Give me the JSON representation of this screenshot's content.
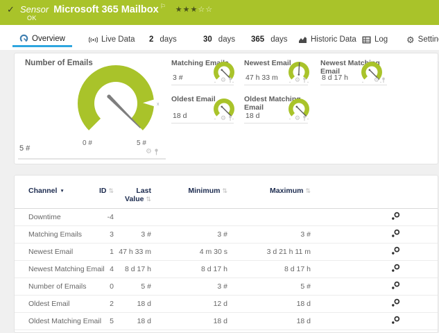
{
  "header": {
    "status_icon": "✓",
    "kind": "Sensor",
    "title": "Microsoft 365 Mailbox",
    "flag_icon": "⚐",
    "stars_filled": "★★★",
    "stars_empty": "☆☆",
    "priority": "3 of 5 stars",
    "status": "OK",
    "bar_color": "#a9c32a"
  },
  "tabs": {
    "overview": {
      "label": "Overview",
      "icon": "gauge-icon",
      "active": true
    },
    "live_data": {
      "label": "Live Data",
      "icon": "broadcast-icon"
    },
    "days2": {
      "num": "2",
      "label": "days"
    },
    "days30": {
      "num": "30",
      "label": "days"
    },
    "days365": {
      "num": "365",
      "label": "days"
    },
    "historic": {
      "label": "Historic Data",
      "icon": "area-chart-icon"
    },
    "log": {
      "label": "Log",
      "icon": "table-icon"
    },
    "settings": {
      "label": "Settings",
      "icon": "gear-icon"
    }
  },
  "widget_icons": {
    "gear": "⚙"
  },
  "gauges": {
    "accent_color": "#a9c32a",
    "needle_color": "#7e7e7e",
    "main": {
      "title": "Number of Emails",
      "value": "5 #",
      "scale_min": "0 #",
      "scale_max": "5 #"
    },
    "matching_emails": {
      "title": "Matching Emails",
      "value": "3 #",
      "needle": "max"
    },
    "newest_email": {
      "title": "Newest Email",
      "value": "47 h 33 m",
      "needle": "mid"
    },
    "newest_matching_email": {
      "title": "Newest Matching Email",
      "value": "8 d 17 h",
      "needle": "max"
    },
    "oldest_email": {
      "title": "Oldest Email",
      "value": "18 d",
      "needle": "max"
    },
    "oldest_matching_email": {
      "title": "Oldest Matching Email",
      "value": "18 d",
      "needle": "max"
    }
  },
  "table": {
    "headers": {
      "channel": "Channel",
      "id": "ID",
      "last_value": "Last Value",
      "minimum": "Minimum",
      "maximum": "Maximum"
    },
    "rows": [
      {
        "channel": "Downtime",
        "id": "-4",
        "last": "",
        "min": "",
        "max": ""
      },
      {
        "channel": "Matching Emails",
        "id": "3",
        "last": "3 #",
        "min": "3 #",
        "max": "3 #"
      },
      {
        "channel": "Newest Email",
        "id": "1",
        "last": "47 h 33 m",
        "min": "4 m 30 s",
        "max": "3 d 21 h 11 m"
      },
      {
        "channel": "Newest Matching Email",
        "id": "4",
        "last": "8 d 17 h",
        "min": "8 d 17 h",
        "max": "8 d 17 h"
      },
      {
        "channel": "Number of Emails",
        "id": "0",
        "last": "5 #",
        "min": "3 #",
        "max": "5 #"
      },
      {
        "channel": "Oldest Email",
        "id": "2",
        "last": "18 d",
        "min": "12 d",
        "max": "18 d"
      },
      {
        "channel": "Oldest Matching Email",
        "id": "5",
        "last": "18 d",
        "min": "18 d",
        "max": "18 d"
      }
    ]
  }
}
